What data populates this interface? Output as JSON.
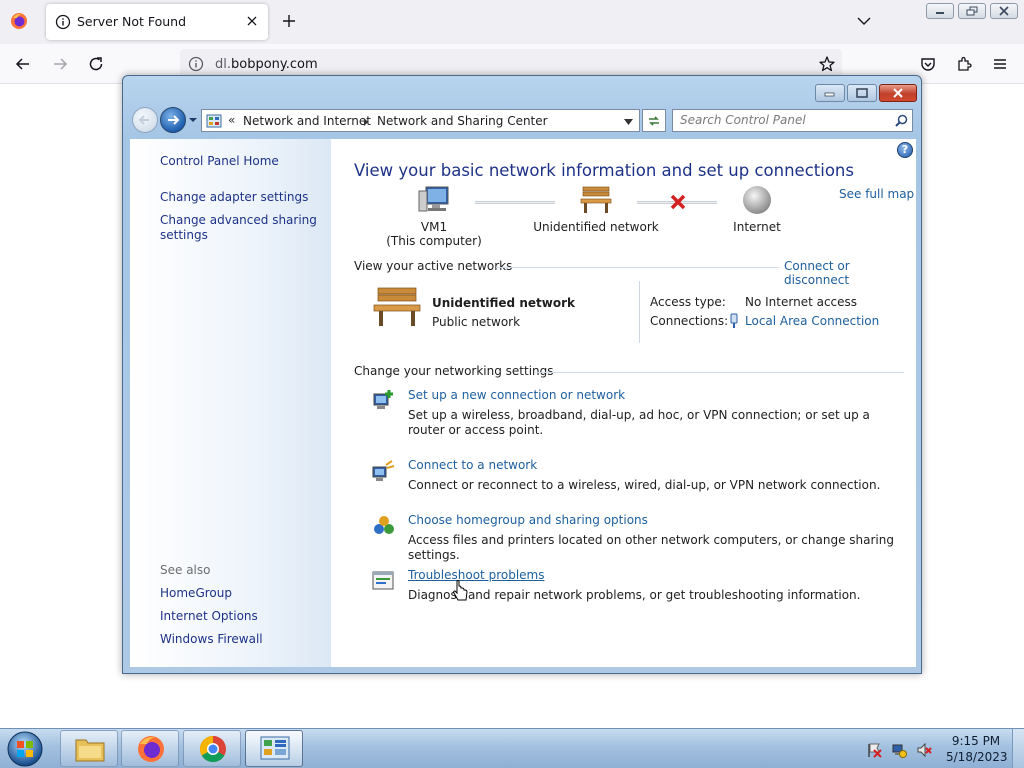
{
  "browser": {
    "tab_title": "Server Not Found",
    "url_prefix": "dl.",
    "url_domain": "bobpony.com"
  },
  "window": {
    "breadcrumb": [
      "Network and Internet",
      "Network and Sharing Center"
    ],
    "search_placeholder": "Search Control Panel"
  },
  "sidebar": {
    "home": "Control Panel Home",
    "items": [
      "Change adapter settings",
      "Change advanced sharing settings"
    ],
    "see_also_label": "See also",
    "see_also": [
      "HomeGroup",
      "Internet Options",
      "Windows Firewall"
    ]
  },
  "main": {
    "title": "View your basic network information and set up connections",
    "see_full_map": "See full map",
    "map": {
      "computer_name": "VM1",
      "computer_note": "(This computer)",
      "network": "Unidentified network",
      "internet": "Internet",
      "internet_connected": false
    },
    "active_networks_label": "View your active networks",
    "connect_or_disconnect": "Connect or disconnect",
    "active_network": {
      "name": "Unidentified network",
      "type": "Public network",
      "access_type_label": "Access type:",
      "access_type": "No Internet access",
      "connections_label": "Connections:",
      "connection": "Local Area Connection"
    },
    "settings_label": "Change your networking settings",
    "tasks": [
      {
        "link": "Set up a new connection or network",
        "desc": "Set up a wireless, broadband, dial-up, ad hoc, or VPN connection; or set up a router or access point.",
        "icon": "new-connection-icon"
      },
      {
        "link": "Connect to a network",
        "desc": "Connect or reconnect to a wireless, wired, dial-up, or VPN network connection.",
        "icon": "connect-network-icon"
      },
      {
        "link": "Choose homegroup and sharing options",
        "desc": "Access files and printers located on other network computers, or change sharing settings.",
        "icon": "homegroup-icon"
      },
      {
        "link": "Troubleshoot problems",
        "desc": "Diagnose and repair network problems, or get troubleshooting information.",
        "icon": "troubleshoot-icon"
      }
    ]
  },
  "taskbar": {
    "time": "9:15 PM",
    "date": "5/18/2023"
  },
  "colors": {
    "link": "#1e5f9e",
    "title": "#1e3287",
    "close_red": "#c1402a"
  }
}
